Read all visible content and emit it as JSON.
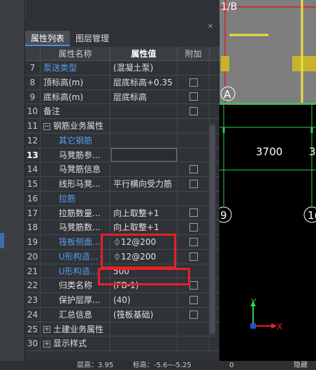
{
  "panel": {
    "close_icon": "×",
    "tabs": [
      {
        "label": "属性列表"
      },
      {
        "label": "图层管理"
      }
    ],
    "headers": {
      "name": "属性名称",
      "value": "属性值",
      "extra": "附加"
    },
    "rows": [
      {
        "num": "7",
        "name": "泵送类型",
        "value": "(混凝土泵)"
      },
      {
        "num": "8",
        "name": "顶标高(m)",
        "value": "层底标高+0.35"
      },
      {
        "num": "9",
        "name": "底标高(m)",
        "value": "层底标高"
      },
      {
        "num": "10",
        "name": "备注",
        "value": ""
      },
      {
        "num": "11",
        "name": "钢筋业务属性",
        "value": "",
        "tree": "−"
      },
      {
        "num": "12",
        "name": "其它钢筋",
        "value": ""
      },
      {
        "num": "13",
        "name": "马凳筋参...",
        "value": ""
      },
      {
        "num": "14",
        "name": "马凳筋信息",
        "value": ""
      },
      {
        "num": "15",
        "name": "线形马凳...",
        "value": "平行横向受力筋"
      },
      {
        "num": "16",
        "name": "拉筋",
        "value": ""
      },
      {
        "num": "17",
        "name": "拉筋数量...",
        "value": "向上取整+1"
      },
      {
        "num": "18",
        "name": "马凳筋数...",
        "value": "向上取整+1"
      },
      {
        "num": "19",
        "name": "筏板侧面...",
        "value": "12@200",
        "glyph": "⏀"
      },
      {
        "num": "20",
        "name": "U形构造...",
        "value": "12@200",
        "glyph": "⏀"
      },
      {
        "num": "21",
        "name": "U形构造...",
        "value": "500"
      },
      {
        "num": "22",
        "name": "归类名称",
        "value": "(FB-1)"
      },
      {
        "num": "23",
        "name": "保护层厚...",
        "value": "(40)"
      },
      {
        "num": "24",
        "name": "汇总信息",
        "value": "(筏板基础)"
      },
      {
        "num": "25",
        "name": "土建业务属性",
        "value": "",
        "tree": "+"
      },
      {
        "num": "30",
        "name": "显示样式",
        "value": "",
        "tree": "+"
      }
    ]
  },
  "canvas": {
    "label_top": "1/B",
    "label_a": "A",
    "dimension_1": "3700",
    "dimension_2": "3",
    "axis_9": "9",
    "axis_10": "1(",
    "axis_y": "Y",
    "axis_x": "X"
  },
  "statusbar": {
    "item1": "层高：3.95",
    "item2": "标高：-5.6~-5.25",
    "item3": "0",
    "item4": "隐藏"
  },
  "colors": {
    "highlight_red": "#e8202a",
    "link_blue": "#5a9df0",
    "axis_green": "#2dd04a",
    "yellow": "#f0e040"
  }
}
